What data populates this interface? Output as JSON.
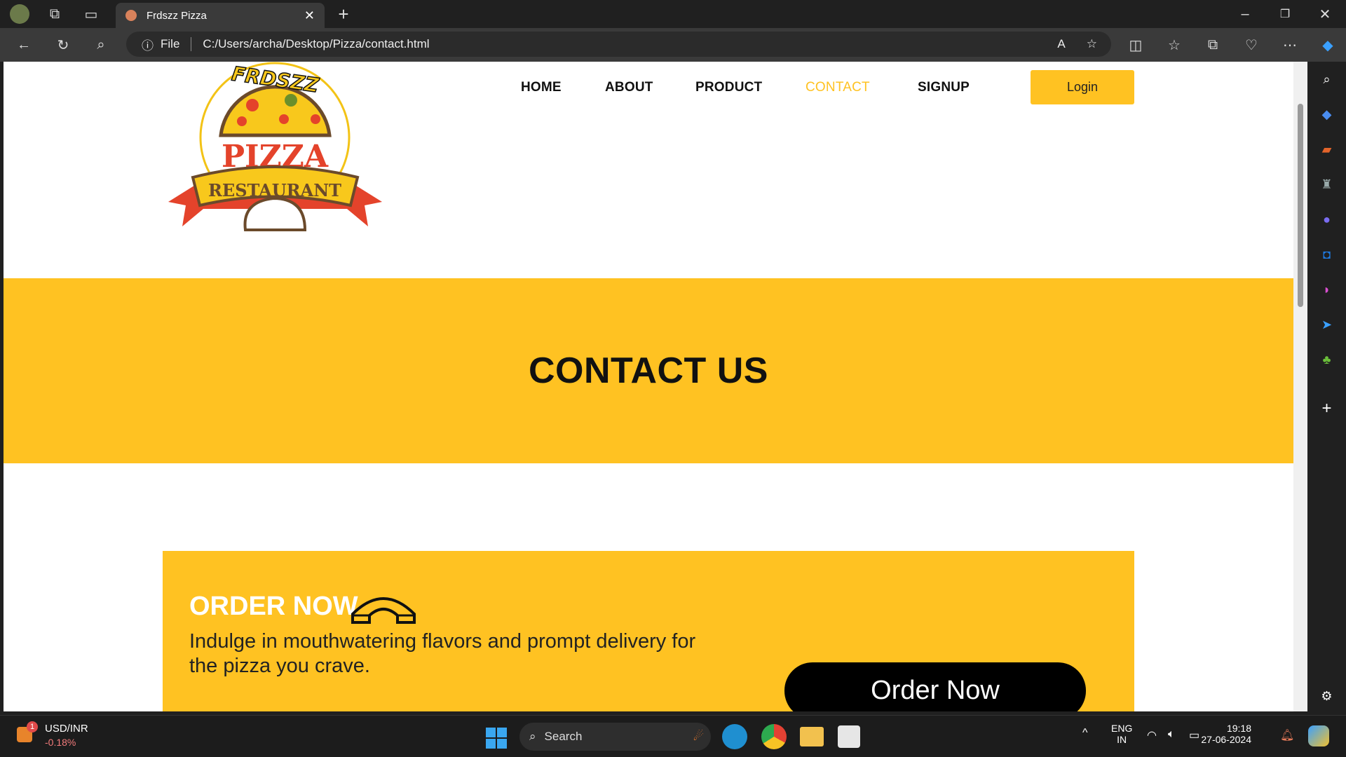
{
  "browser": {
    "tab_title": "Frdszz Pizza",
    "url_label": "File",
    "url": "C:/Users/archa/Desktop/Pizza/contact.html"
  },
  "logo": {
    "brand": "FRDSZZ",
    "word": "PIZZA",
    "banner": "RESTAURANT"
  },
  "nav": {
    "items": [
      "HOME",
      "ABOUT",
      "PRODUCT",
      "CONTACT",
      "SIGNUP"
    ],
    "active": "CONTACT",
    "login": "Login"
  },
  "hero": {
    "title": "CONTACT US"
  },
  "order": {
    "heading": "ORDER NOW",
    "text": "Indulge in mouthwatering flavors and prompt delivery for the pizza you crave.",
    "button": "Order Now"
  },
  "taskbar": {
    "ticker": "USD/INR",
    "change": "-0.18%",
    "badge": "1",
    "search": "Search",
    "lang1": "ENG",
    "lang2": "IN",
    "time": "19:18",
    "date": "27-06-2024"
  },
  "colors": {
    "accent": "#ffc222"
  }
}
